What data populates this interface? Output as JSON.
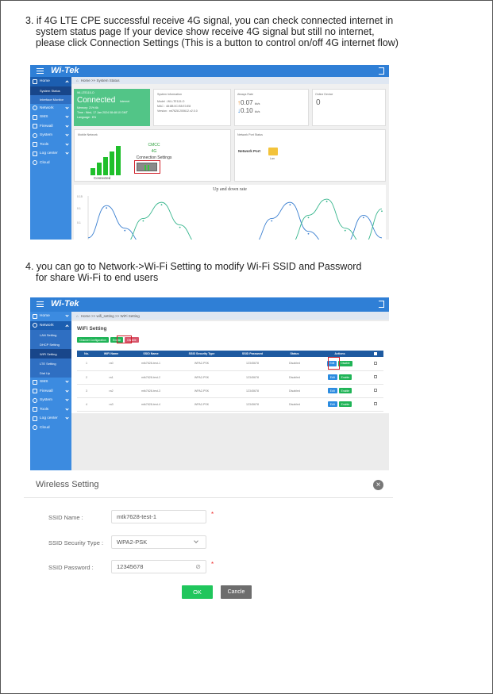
{
  "step3": {
    "lines": [
      "3. if 4G LTE CPE successful receive 4G signal, you can check connected internet in",
      "system status page If your device show receive 4G signal but still no internet,",
      "please click Connection Settings (This is a button to control on/off 4G internet flow)"
    ]
  },
  "step4": {
    "lines": [
      "4. you can go to Network->Wi-Fi Setting to modify Wi-Fi SSID and Password",
      "for share Wi-Fi to end users"
    ]
  },
  "brand": {
    "logo": "Wi-Tek",
    "accent": "#2f7fd6",
    "sidebar": "#3c8be0",
    "sidebar_active": "#18468a"
  },
  "shot1": {
    "breadcrumb": "Home >> System Status",
    "menu": [
      {
        "label": "Home",
        "icon": "home-icon"
      },
      {
        "label": "System Status",
        "icon": ""
      },
      {
        "label": "Interface Monitor",
        "icon": ""
      },
      {
        "label": "Network",
        "icon": "globe-icon"
      },
      {
        "label": "SMS",
        "icon": "mail-icon"
      },
      {
        "label": "Firewall",
        "icon": "firewall-icon"
      },
      {
        "label": "System",
        "icon": "gear-icon"
      },
      {
        "label": "Tools",
        "icon": "tools-icon"
      },
      {
        "label": "Log center",
        "icon": "log-icon"
      },
      {
        "label": "Cloud",
        "icon": "cloud-icon"
      }
    ],
    "status_card": {
      "model": "WI-LTE115-O",
      "state": "Connected",
      "state_sub": "Internet",
      "memory": "Memory: 21%",
      "memory_val": "6k",
      "time": "Time : Wed, 17 Jan 2024 08:48:10 GMT",
      "language": "Language : EN"
    },
    "sysinfo": {
      "title": "System Information",
      "model": "Model : WI-LTE115-O",
      "mac": "MAC : 48:8B:0C:E8:E3:E8",
      "version": "Version : mt7628.200612.v2.0.0"
    },
    "rates": {
      "title": "Always Rate",
      "up": "0.07",
      "down": "0.10",
      "unit": "kb/s"
    },
    "online": {
      "title": "Online Device",
      "count": "0"
    },
    "mobile": {
      "title": "Mobile Network",
      "operator": "CMCC",
      "net": "4G",
      "connection_settings": "Connection Settings",
      "status": "Connected"
    },
    "port": {
      "title": "Network Port Status",
      "label": "Network Port",
      "lan": "Lan"
    },
    "chart_data": {
      "type": "line",
      "title": "Up and down rate",
      "ylabel": "",
      "yticks": [
        "0.15",
        "0.1",
        "0.1"
      ],
      "series": [
        {
          "name": "",
          "color": "#3a7fd0",
          "values": [
            0.02,
            0.12,
            0.05,
            0.0,
            0.0,
            0.0,
            0.0,
            0.0,
            0.0,
            0.0,
            0.08,
            0.13,
            0.04,
            0.0,
            0.0,
            0.09,
            0.02
          ]
        },
        {
          "name": "",
          "color": "#35b58c",
          "values": [
            0.0,
            0.0,
            0.0,
            0.08,
            0.13,
            0.06,
            0.0,
            0.0,
            0.0,
            0.0,
            0.0,
            0.0,
            0.09,
            0.14,
            0.05,
            0.0,
            0.11
          ]
        }
      ]
    }
  },
  "shot2": {
    "breadcrumb": "Home >> wifi_setting >> WiFi Setting",
    "menu": [
      {
        "label": "Home",
        "icon": "home-icon"
      },
      {
        "label": "Network",
        "icon": "globe-icon"
      },
      {
        "label": "LAN Setting",
        "icon": ""
      },
      {
        "label": "DHCP Setting",
        "icon": ""
      },
      {
        "label": "WiFi Setting",
        "icon": ""
      },
      {
        "label": "LTE Setting",
        "icon": ""
      },
      {
        "label": "Dial Up",
        "icon": ""
      },
      {
        "label": "SMS",
        "icon": "mail-icon"
      },
      {
        "label": "Firewall",
        "icon": "firewall-icon"
      },
      {
        "label": "System",
        "icon": "gear-icon"
      },
      {
        "label": "Tools",
        "icon": "tools-icon"
      },
      {
        "label": "Log center",
        "icon": "log-icon"
      },
      {
        "label": "Cloud",
        "icon": "cloud-icon"
      }
    ],
    "heading": "WiFi Setting",
    "buttons": {
      "channel": "Channel Configuration",
      "enable": "Enable",
      "disable": "Disable"
    },
    "columns": [
      "No.",
      "WiFi Name",
      "SSID Name",
      "SSID Security Type",
      "SSID Password",
      "Status",
      "Actions"
    ],
    "rows": [
      {
        "no": "1",
        "name": "ra0",
        "ssid": "mtk7628-test-1",
        "sec": "WPA2-PSK",
        "pwd": "12345678",
        "status": "Disabled"
      },
      {
        "no": "2",
        "name": "ra1",
        "ssid": "mtk7628-test-2",
        "sec": "WPA2-PSK",
        "pwd": "12345678",
        "status": "Disabled"
      },
      {
        "no": "3",
        "name": "ra2",
        "ssid": "mtk7628-test-3",
        "sec": "WPA2-PSK",
        "pwd": "12345678",
        "status": "Disabled"
      },
      {
        "no": "4",
        "name": "ra3",
        "ssid": "mtk7628-test-4",
        "sec": "WPA2-PSK",
        "pwd": "12345678",
        "status": "Disabled"
      }
    ],
    "row_actions": {
      "edit": "Edit",
      "enable": "Enable",
      "disable": "Disable"
    }
  },
  "dialog": {
    "title": "Wireless Setting",
    "ssid_label": "SSID Name :",
    "ssid_value": "mtk7628-test-1",
    "sec_label": "SSID Security Type :",
    "sec_value": "WPA2-PSK",
    "pwd_label": "SSID Password :",
    "pwd_value": "12345678",
    "ok": "OK",
    "cancel": "Cancle"
  }
}
